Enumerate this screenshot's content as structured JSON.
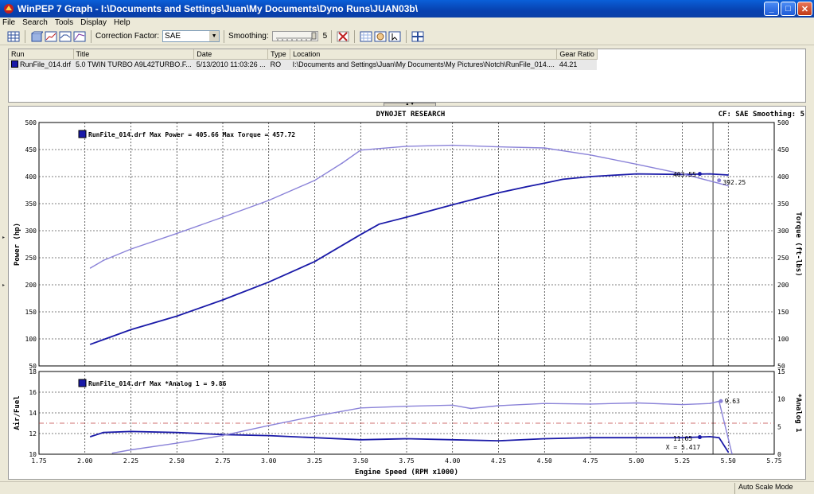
{
  "window": {
    "title": "WinPEP 7   Graph - I:\\Documents and Settings\\Juan\\My Documents\\Dyno Runs\\JUAN03b\\"
  },
  "menu": [
    "File",
    "Search",
    "Tools",
    "Display",
    "Help"
  ],
  "toolbar": {
    "correction_label": "Correction Factor:",
    "correction_value": "SAE",
    "smoothing_label": "Smoothing:",
    "smoothing_value": "5"
  },
  "runs": {
    "columns": [
      "Run",
      "Title",
      "Date",
      "Type",
      "Location",
      "Gear Ratio"
    ],
    "rows": [
      [
        "RunFile_014.drf",
        "5.0 TWIN TURBO  A9L42TURBO.F...",
        "5/13/2010 11:03:26 ...",
        "RO",
        "I:\\Documents and Settings\\Juan\\My Documents\\My Pictures\\Notch\\RunFile_014....",
        "44.21"
      ]
    ]
  },
  "graph": {
    "header": "DYNOJET RESEARCH",
    "cf_label": "CF: SAE  Smoothing: 5",
    "statusbar": "Auto Scale Mode"
  },
  "chart_data": [
    {
      "type": "line",
      "ylabel": "Power (hp)",
      "y2label": "Torque (ft-lbs)",
      "ylim": [
        50,
        500
      ],
      "y2lim": [
        50,
        500
      ],
      "xlim": [
        1.75,
        5.75
      ],
      "legend": "RunFile_014.drf Max Power = 405.66 Max Torque = 457.72",
      "annotations": [
        "403.55",
        "392.25"
      ],
      "series": [
        {
          "name": "Power",
          "color": "#1a1aa8",
          "x": [
            2.03,
            2.25,
            2.5,
            2.75,
            3.0,
            3.25,
            3.5,
            3.6,
            3.75,
            4.0,
            4.25,
            4.4,
            4.5,
            4.6,
            4.75,
            5.0,
            5.25,
            5.4,
            5.5
          ],
          "y": [
            90,
            117,
            142,
            172,
            205,
            243,
            293,
            312,
            325,
            348,
            370,
            381,
            388,
            395,
            400,
            405,
            404,
            405,
            403
          ]
        },
        {
          "name": "Torque",
          "color": "#8a82d8",
          "x": [
            2.03,
            2.1,
            2.25,
            2.5,
            2.75,
            3.0,
            3.25,
            3.4,
            3.5,
            3.75,
            4.0,
            4.25,
            4.5,
            4.75,
            5.0,
            5.25,
            5.4,
            5.5
          ],
          "y": [
            231,
            245,
            266,
            295,
            325,
            356,
            393,
            425,
            449,
            456,
            458,
            455,
            453,
            440,
            423,
            405,
            392,
            383
          ]
        }
      ]
    },
    {
      "type": "line",
      "ylabel": "Air/Fuel",
      "y2label": "*Analog 1",
      "ylim": [
        10,
        18
      ],
      "y2lim": [
        0,
        15
      ],
      "xlim": [
        1.75,
        5.75
      ],
      "xlabel": "Engine Speed (RPM x1000)",
      "xticks": [
        "1.75",
        "2.00",
        "2.25",
        "2.50",
        "2.75",
        "3.00",
        "3.25",
        "3.50",
        "3.75",
        "4.00",
        "4.25",
        "4.50",
        "4.75",
        "5.00",
        "5.25",
        "5.50",
        "5.75"
      ],
      "legend": "RunFile_014.drf Max *Analog 1 = 9.86",
      "annotations": [
        "11.65",
        "9.63",
        "X = 5.417"
      ],
      "reference_line": 13.0,
      "series": [
        {
          "name": "Air/Fuel",
          "color": "#1a1aa8",
          "x": [
            2.03,
            2.1,
            2.25,
            2.5,
            2.75,
            3.0,
            3.25,
            3.5,
            3.75,
            4.0,
            4.25,
            4.5,
            4.75,
            5.0,
            5.25,
            5.4,
            5.45,
            5.5
          ],
          "y": [
            11.7,
            12.1,
            12.2,
            12.1,
            11.9,
            11.8,
            11.6,
            11.4,
            11.5,
            11.4,
            11.3,
            11.5,
            11.6,
            11.6,
            11.6,
            11.7,
            11.6,
            10.2
          ]
        },
        {
          "name": "*Analog 1",
          "color": "#8a82d8",
          "x": [
            2.15,
            2.25,
            2.5,
            2.75,
            3.0,
            3.25,
            3.5,
            3.75,
            4.0,
            4.1,
            4.25,
            4.5,
            4.75,
            5.0,
            5.25,
            5.4,
            5.45,
            5.52
          ],
          "y": [
            0.2,
            0.8,
            2.0,
            3.4,
            5.2,
            6.9,
            8.4,
            8.7,
            8.9,
            8.3,
            8.8,
            9.2,
            9.1,
            9.3,
            9.0,
            9.2,
            9.6,
            0.1
          ]
        }
      ]
    }
  ]
}
